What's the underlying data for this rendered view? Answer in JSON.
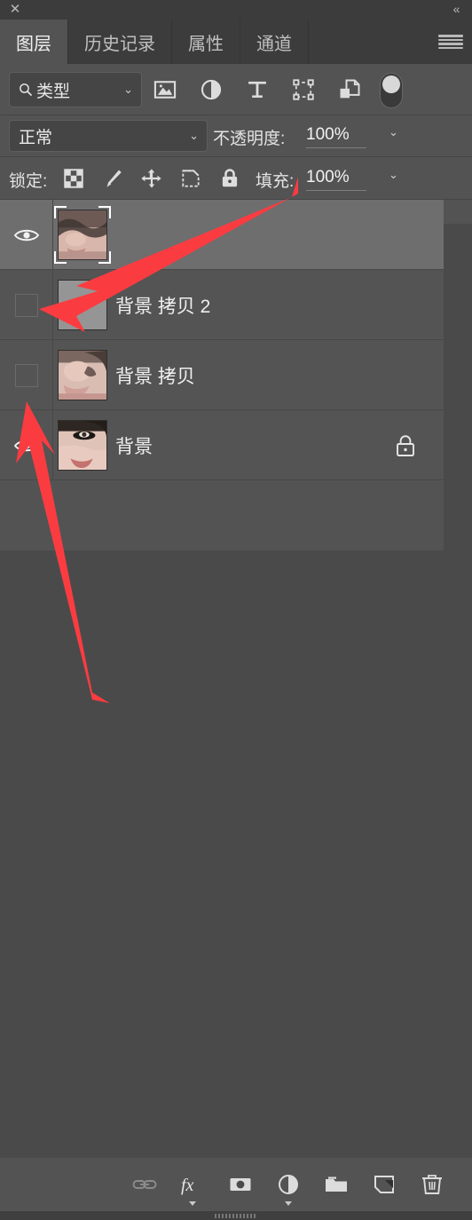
{
  "window": {
    "close_label": "✕",
    "collapse_label": "«",
    "menu_icon": "hamburger-menu-icon"
  },
  "tabs": [
    {
      "label": "图层",
      "active": true
    },
    {
      "label": "历史记录",
      "active": false
    },
    {
      "label": "属性",
      "active": false
    },
    {
      "label": "通道",
      "active": false
    }
  ],
  "filter": {
    "search_icon": "search-icon",
    "type_label": "类型",
    "chevron": "⌄",
    "icons": [
      {
        "name": "pixel-layer-filter-icon"
      },
      {
        "name": "adjustment-layer-filter-icon"
      },
      {
        "name": "type-layer-filter-icon"
      },
      {
        "name": "shape-layer-filter-icon"
      },
      {
        "name": "smart-object-filter-icon"
      }
    ],
    "toggle_name": "filter-enable-toggle",
    "toggle_on": false
  },
  "blend": {
    "mode_label": "正常",
    "chevron": "⌄",
    "opacity_label": "不透明度:",
    "opacity_value": "100%",
    "opacity_chevron": "⌄"
  },
  "lock": {
    "label": "锁定:",
    "icons": [
      {
        "name": "lock-transparent-pixels-icon"
      },
      {
        "name": "lock-image-pixels-icon"
      },
      {
        "name": "lock-position-icon"
      },
      {
        "name": "lock-artboard-nesting-icon"
      },
      {
        "name": "lock-all-icon"
      }
    ],
    "fill_label": "填充:",
    "fill_value": "100%",
    "fill_chevron": "⌄"
  },
  "layers": [
    {
      "name": "",
      "visible": true,
      "selected": true,
      "locked": false,
      "thumb": "portrait-photo",
      "thumb_selected_outline": true
    },
    {
      "name": "背景 拷贝 2",
      "visible": false,
      "selected": false,
      "locked": false,
      "thumb": "gray-fill"
    },
    {
      "name": "背景 拷贝",
      "visible": false,
      "selected": false,
      "locked": false,
      "thumb": "portrait-photo"
    },
    {
      "name": "背景",
      "visible": true,
      "selected": false,
      "locked": true,
      "thumb": "portrait-photo"
    }
  ],
  "bottom_toolbar": [
    {
      "name": "link-layers-button",
      "dimmed": true
    },
    {
      "name": "layer-style-fx-button",
      "dimmed": false
    },
    {
      "name": "add-layer-mask-button",
      "dimmed": false
    },
    {
      "name": "new-adjustment-layer-button",
      "dimmed": false
    },
    {
      "name": "new-group-button",
      "dimmed": false
    },
    {
      "name": "new-layer-button",
      "dimmed": false
    },
    {
      "name": "delete-layer-button",
      "dimmed": false
    }
  ],
  "annotations": {
    "arrow_color": "#fa3c41",
    "arrows": [
      {
        "name": "arrow-to-visibility-toggle-top"
      },
      {
        "name": "arrow-to-visibility-toggle-background"
      }
    ]
  },
  "colors": {
    "panel_bg": "#535353",
    "row_bg": "#545454",
    "row_selected_bg": "#6e6e6e",
    "empty_bg": "#4a4a4a",
    "tab_bg": "#3c3c3c",
    "text": "#f0f0f0"
  }
}
